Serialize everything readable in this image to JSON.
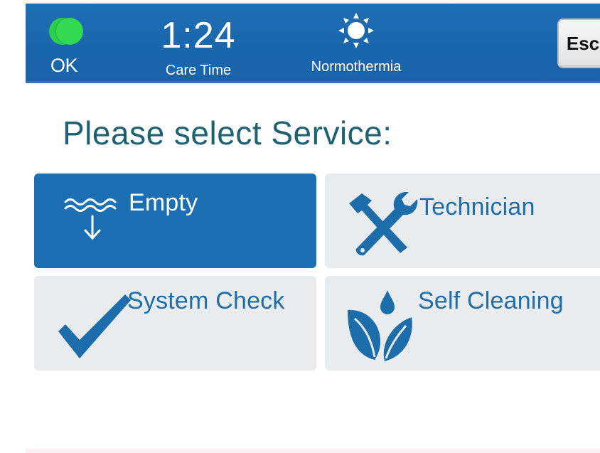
{
  "header": {
    "status_label": "OK",
    "status_color": "#2ed04b",
    "care_time": "1:24",
    "care_label": "Care Time",
    "temperature_label": "Normothermia",
    "temperature_icon": "sun-icon",
    "esc_label": "Esc",
    "background_color": "#1f6fb5"
  },
  "main": {
    "title": "Please select Service:",
    "tiles": [
      {
        "label": "Empty",
        "icon": "drain-waves-icon",
        "selected": true
      },
      {
        "label": "Technician",
        "icon": "tools-icon",
        "selected": false
      },
      {
        "label": "System Check",
        "icon": "checkmark-icon",
        "selected": false
      },
      {
        "label": "Self Cleaning",
        "icon": "water-drop-leaves-icon",
        "selected": false
      }
    ]
  },
  "colors": {
    "accent": "#1d6fb3",
    "tile_background": "#e9ecef",
    "title_color": "#1f6072"
  }
}
